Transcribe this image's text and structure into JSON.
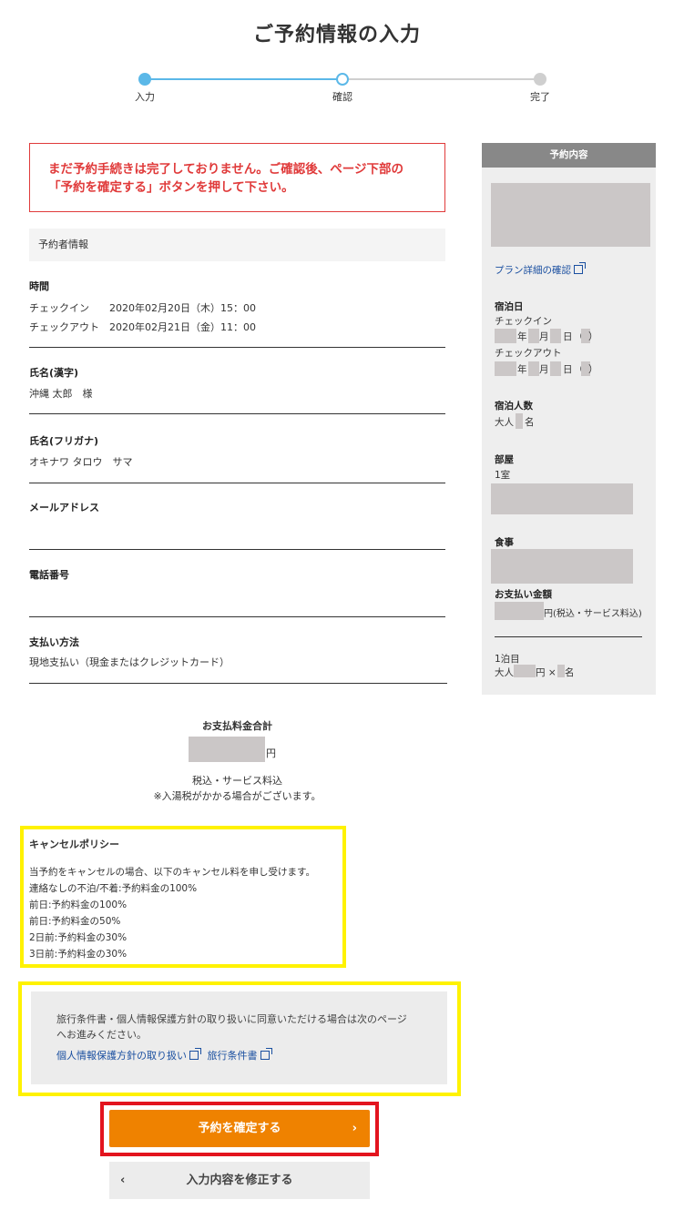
{
  "page_title": "ご予約情報の入力",
  "stepper": {
    "steps": [
      {
        "label": "入力",
        "state": "done"
      },
      {
        "label": "確認",
        "state": "current"
      },
      {
        "label": "完了",
        "state": "todo"
      }
    ]
  },
  "warning": {
    "line1": "まだ予約手続きは完了しておりません。ご確認後、ページ下部の",
    "line2": "「予約を確定する」ボタンを押して下さい。"
  },
  "booker_section": {
    "header": "予約者情報",
    "time_label": "時間",
    "checkin_label": "チェックイン",
    "checkin_value": "2020年02月20日（木）15：00",
    "checkout_label": "チェックアウト",
    "checkout_value": "2020年02月21日（金）11：00",
    "name_kanji_label": "氏名(漢字)",
    "name_kanji_value": "沖縄 太郎　様",
    "name_kana_label": "氏名(フリガナ)",
    "name_kana_value": "オキナワ タロウ　サマ",
    "email_label": "メールアドレス",
    "phone_label": "電話番号",
    "payment_label": "支払い方法",
    "payment_value": "現地支払い（現金またはクレジットカード）"
  },
  "total": {
    "label": "お支払料金合計",
    "currency": "円",
    "tax_note": "税込・サービス料込",
    "bath_tax_note": "※入湯税がかかる場合がございます。"
  },
  "cancel_policy": {
    "title": "キャンセルポリシー",
    "lines": [
      "当予約をキャンセルの場合、以下のキャンセル料を申し受けます。",
      "連絡なしの不泊/不着:予約料金の100%",
      "前日:予約料金の100%",
      "前日:予約料金の50%",
      "2日前:予約料金の30%",
      "3日前:予約料金の30%"
    ]
  },
  "agreement": {
    "text_line1": "旅行条件書・個人情報保護方針の取り扱いに同意いただける場合は次のページ",
    "text_line2": "へお進みください。",
    "privacy_link": "個人情報保護方針の取り扱い",
    "terms_link": "旅行条件書"
  },
  "buttons": {
    "confirm": "予約を確定する",
    "confirm_chevron": "›",
    "back": "入力内容を修正する",
    "back_chevron": "‹"
  },
  "sidebar": {
    "header": "予約内容",
    "plan_link": "プラン詳細の確認",
    "stay_label": "宿泊日",
    "checkin_label": "チェックイン",
    "checkout_label": "チェックアウト",
    "year": "年",
    "month": "月",
    "day": "日",
    "paren_open": "（",
    "paren_close": "）",
    "guests_label": "宿泊人数",
    "adult": "大人",
    "persons_unit": "名",
    "room_label": "部屋",
    "room_count": "1室",
    "meal_label": "食事",
    "payment_label": "お支払い金額",
    "payment_suffix": "円(税込・サービス料込)",
    "night_label": "1泊目",
    "per_adult_yen": "円 ×",
    "colors": {
      "header_bg": "#888888",
      "body_bg": "#eeeeee"
    }
  },
  "colors": {
    "accent_orange": "#ef8200",
    "warning_red": "#e03a3a",
    "highlight_yellow": "#fff200",
    "step_blue": "#5bb8e8",
    "link_blue": "#1a4fa0"
  }
}
